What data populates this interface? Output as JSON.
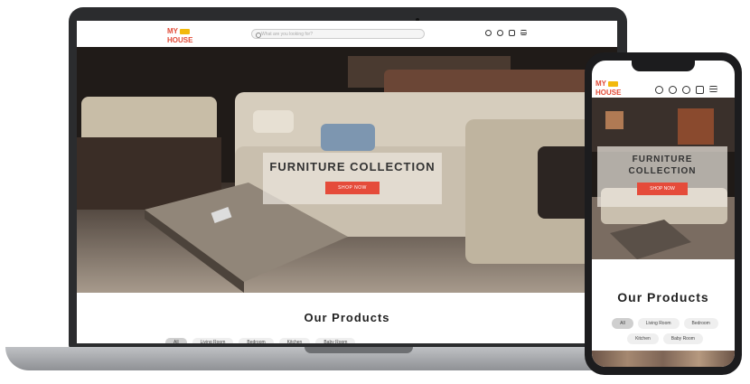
{
  "brand": {
    "line1": "MY",
    "line2": "HOUSE"
  },
  "search": {
    "placeholder": "What are you looking for?"
  },
  "hero": {
    "title": "FURNITURE COLLECTION",
    "cta": "SHOP NOW"
  },
  "products": {
    "heading": "Our Products",
    "categories": [
      "All",
      "Living Room",
      "Bedroom",
      "Kitchen",
      "Baby Room"
    ],
    "active": "All"
  },
  "mobile": {
    "hero_title_line1": "FURNITURE",
    "hero_title_line2": "COLLECTION"
  },
  "colors": {
    "accent": "#e54b3a",
    "brand": "#e14a36",
    "crown": "#f2b90c"
  },
  "icons": [
    "search-icon",
    "user-icon",
    "heart-icon",
    "cart-icon",
    "menu-icon"
  ]
}
